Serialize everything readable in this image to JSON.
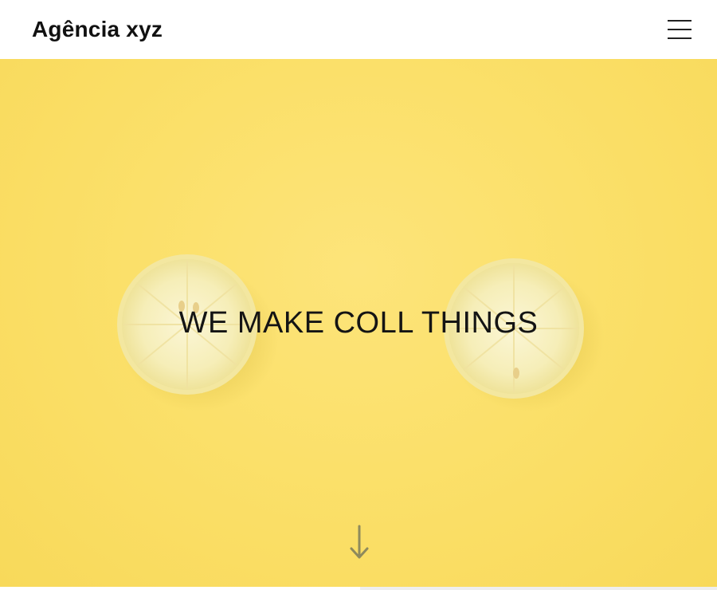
{
  "header": {
    "brand": "Agência xyz",
    "menu_icon": "hamburger-menu-icon"
  },
  "hero": {
    "title": "WE MAKE COLL THINGS",
    "background_color": "#fbe06a",
    "scroll_icon": "arrow-down-icon"
  }
}
